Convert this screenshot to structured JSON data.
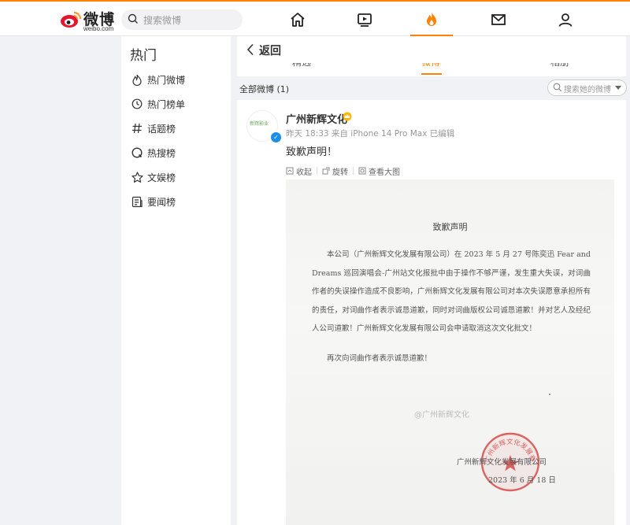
{
  "header": {
    "logo_text": "微博",
    "logo_url": "weibo.com",
    "search_placeholder": "搜索微博",
    "nav": [
      "home-icon",
      "video-icon",
      "hot-icon",
      "mail-icon",
      "profile-icon"
    ],
    "active_nav": "hot-icon",
    "accent": "#ff8200"
  },
  "sidebar": {
    "title": "热门",
    "items": [
      {
        "label": "热门微博",
        "icon": "flame-icon"
      },
      {
        "label": "热门榜单",
        "icon": "clock-icon"
      },
      {
        "label": "话题榜",
        "icon": "hashtag-icon"
      },
      {
        "label": "热搜榜",
        "icon": "search-ring-icon"
      },
      {
        "label": "文娱榜",
        "icon": "star-icon"
      },
      {
        "label": "要闻榜",
        "icon": "news-icon"
      }
    ]
  },
  "main": {
    "back_label": "返回",
    "tabs": [
      {
        "label": "精选"
      },
      {
        "label": "微博",
        "active": true
      },
      {
        "label": "相册"
      }
    ],
    "filter_label": "全部微博 (1)",
    "filter_search_placeholder": "搜索她的微博"
  },
  "post": {
    "author": "广州新辉文化",
    "avatar_mark": "新辉影业",
    "meta": "昨天 18:33  来自 iPhone 14 Pro Max 已编辑",
    "content": "致歉声明！",
    "actions": [
      {
        "label": "收起",
        "icon": "collapse-icon"
      },
      {
        "label": "旋转",
        "icon": "rotate-icon"
      },
      {
        "label": "查看大图",
        "icon": "zoom-icon"
      }
    ]
  },
  "document": {
    "title": "致歉声明",
    "body": "本公司（广州新辉文化发展有限公司）在 2023 年 5 月 27 号陈奕迅 Fear and Dreams 巡回演唱会-广州站文化报批中由于操作不够严谨，发生重大失误，对词曲作者的失误操作造成不良影响，广州新辉文化发展有限公司对本次失误愿意承担所有的责任，对词曲作者表示诚恳道歉，同时对词曲版权公司诚恳道歉！并对艺人及经纪人公司道歉！广州新辉文化发展有限公司会申请取消这次文化批文！",
    "body2": "再次向词曲作者表示诚恳道歉！",
    "watermark": "@广州新辉文化",
    "signature": "广州新辉文化发展有限公司",
    "date": "2023 年 6 月 18 日",
    "seal_text": "广州新辉文化发展有限公司"
  }
}
